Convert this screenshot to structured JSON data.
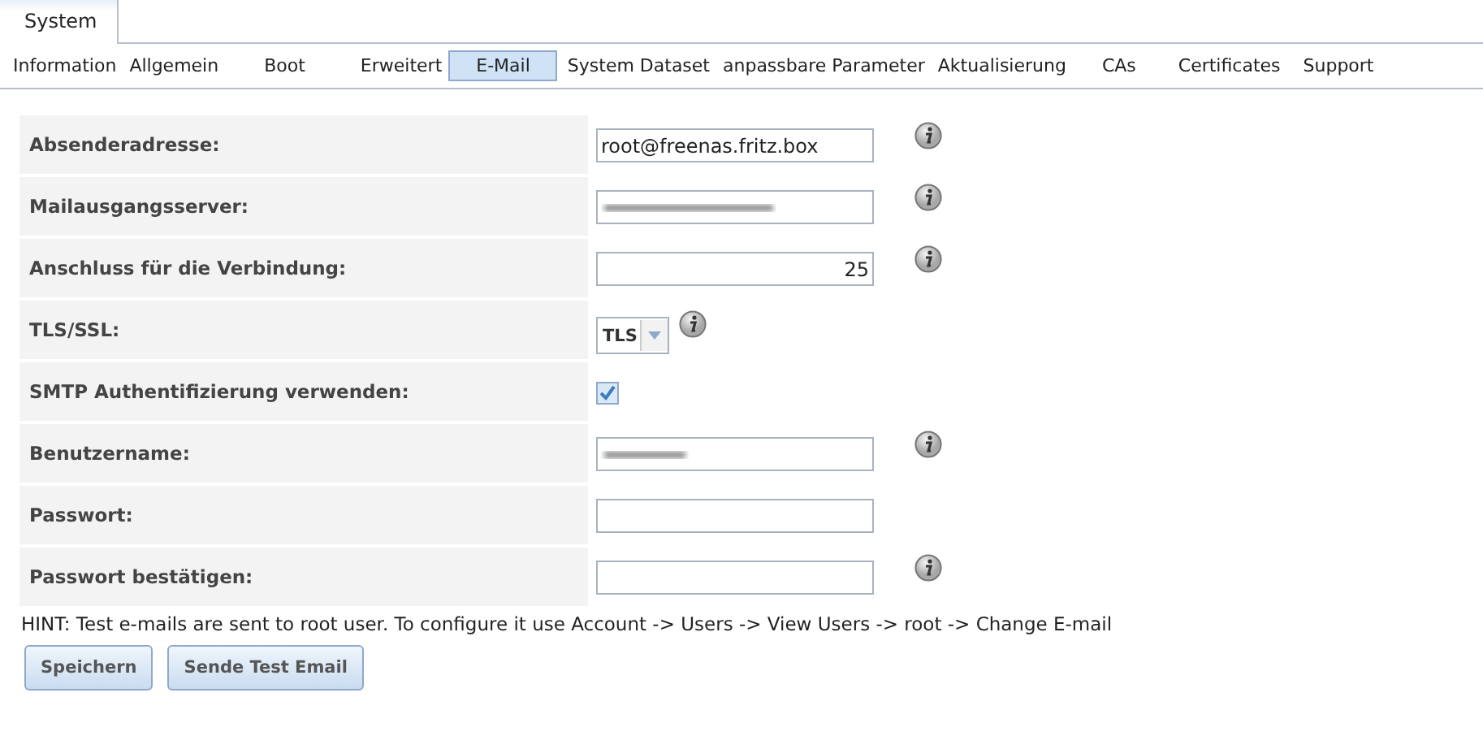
{
  "top_tabs": [
    {
      "label": "System",
      "selected": true
    }
  ],
  "sub_tabs": [
    {
      "label": "Information",
      "selected": false
    },
    {
      "label": "Allgemein",
      "selected": false
    },
    {
      "label": "Boot",
      "selected": false
    },
    {
      "label": "Erweitert",
      "selected": false
    },
    {
      "label": "E-Mail",
      "selected": true
    },
    {
      "label": "System Dataset",
      "selected": false
    },
    {
      "label": "anpassbare Parameter",
      "selected": false
    },
    {
      "label": "Aktualisierung",
      "selected": false
    },
    {
      "label": "CAs",
      "selected": false
    },
    {
      "label": "Certificates",
      "selected": false
    },
    {
      "label": "Support",
      "selected": false
    }
  ],
  "form_rows": [
    {
      "label": "Absenderadresse:",
      "kind": "text",
      "value": "root@freenas.fritz.box",
      "info": true
    },
    {
      "label": "Mailausgangsserver:",
      "kind": "text",
      "redacted": true,
      "info": true
    },
    {
      "label": "Anschluss für die Verbindung:",
      "kind": "number",
      "value": "25",
      "info": true
    },
    {
      "label": "TLS/SSL:",
      "kind": "select",
      "value": "TLS",
      "info": true
    },
    {
      "label": "SMTP Authentifizierung verwenden:",
      "kind": "checkbox",
      "checked": true,
      "info": false
    },
    {
      "label": "Benutzername:",
      "kind": "text",
      "redacted": true,
      "info": true
    },
    {
      "label": "Passwort:",
      "kind": "password",
      "info": false
    },
    {
      "label": "Passwort bestätigen:",
      "kind": "password",
      "info": true
    }
  ],
  "hint": "HINT: Test e-mails are sent to root user. To configure it use Account -> Users -> View Users -> root -> Change E-mail",
  "buttons": [
    "Speichern",
    "Sende Test Email"
  ]
}
